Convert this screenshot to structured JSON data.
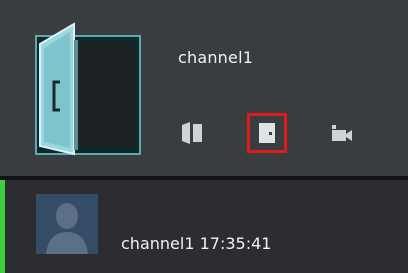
{
  "channel": {
    "name": "channel1",
    "icon": "door-icon"
  },
  "controls": [
    {
      "icon": "door-open-icon",
      "selected": false
    },
    {
      "icon": "door-close-icon",
      "selected": true
    },
    {
      "icon": "video-camera-icon",
      "selected": false
    }
  ],
  "event": {
    "text": "channel1 17:35:41",
    "avatar_icon": "person-icon",
    "accent_color": "#3fcf3f"
  },
  "colors": {
    "selected_border": "#e01b1b"
  }
}
